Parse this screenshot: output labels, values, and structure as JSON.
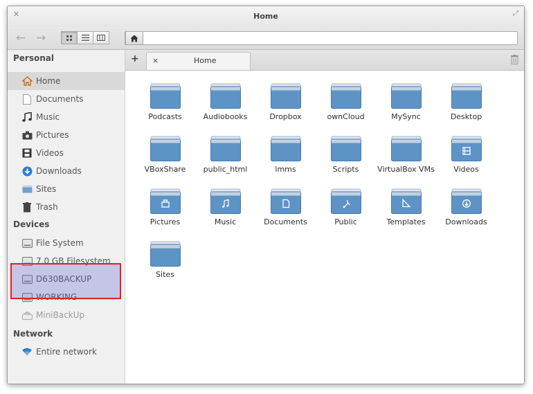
{
  "window": {
    "title": "Home",
    "close_icon": "close-icon",
    "maximize_icon": "maximize-icon"
  },
  "toolbar": {
    "back": "←",
    "forward": "→",
    "view_modes": [
      "icon-view",
      "list-view",
      "column-view"
    ],
    "path_home": "home-icon"
  },
  "sidebar": {
    "sections": [
      {
        "heading": "Personal",
        "items": [
          {
            "label": "Home",
            "icon": "home-icon",
            "selected": true
          },
          {
            "label": "Documents",
            "icon": "document-icon"
          },
          {
            "label": "Music",
            "icon": "music-icon"
          },
          {
            "label": "Pictures",
            "icon": "pictures-icon"
          },
          {
            "label": "Videos",
            "icon": "video-icon"
          },
          {
            "label": "Downloads",
            "icon": "downloads-icon"
          },
          {
            "label": "Sites",
            "icon": "folder-icon"
          },
          {
            "label": "Trash",
            "icon": "trash-icon"
          }
        ]
      },
      {
        "heading": "Devices",
        "items": [
          {
            "label": "File System",
            "icon": "drive-icon"
          },
          {
            "label": "7.0 GB Filesystem",
            "icon": "drive-icon"
          },
          {
            "label": "D630BACKUP",
            "icon": "drive-icon"
          },
          {
            "label": "WORKING",
            "icon": "drive-icon"
          },
          {
            "label": "MiniBackUp",
            "icon": "network-drive-icon"
          }
        ]
      },
      {
        "heading": "Network",
        "items": [
          {
            "label": "Entire network",
            "icon": "wifi-icon"
          }
        ]
      }
    ]
  },
  "tabs": {
    "add_label": "+",
    "close_label": "×",
    "active_label": "Home",
    "trash_icon": "trash-icon"
  },
  "files": [
    {
      "label": "Podcasts",
      "emblem": ""
    },
    {
      "label": "Audiobooks",
      "emblem": ""
    },
    {
      "label": "Dropbox",
      "emblem": ""
    },
    {
      "label": "ownCloud",
      "emblem": ""
    },
    {
      "label": "MySync",
      "emblem": ""
    },
    {
      "label": "Desktop",
      "emblem": ""
    },
    {
      "label": "VBoxShare",
      "emblem": ""
    },
    {
      "label": "public_html",
      "emblem": ""
    },
    {
      "label": "lmms",
      "emblem": ""
    },
    {
      "label": "Scripts",
      "emblem": ""
    },
    {
      "label": "VirtualBox VMs",
      "emblem": ""
    },
    {
      "label": "Videos",
      "emblem": "video"
    },
    {
      "label": "Pictures",
      "emblem": "pictures"
    },
    {
      "label": "Music",
      "emblem": "music"
    },
    {
      "label": "Documents",
      "emblem": "document"
    },
    {
      "label": "Public",
      "emblem": "public"
    },
    {
      "label": "Templates",
      "emblem": "templates"
    },
    {
      "label": "Downloads",
      "emblem": "downloads"
    },
    {
      "label": "Sites",
      "emblem": ""
    }
  ],
  "colors": {
    "folder_top": "#c3d3e3",
    "folder_body": "#5e93c5",
    "highlight_border": "#e02020",
    "highlight_fill": "#6464cd"
  }
}
